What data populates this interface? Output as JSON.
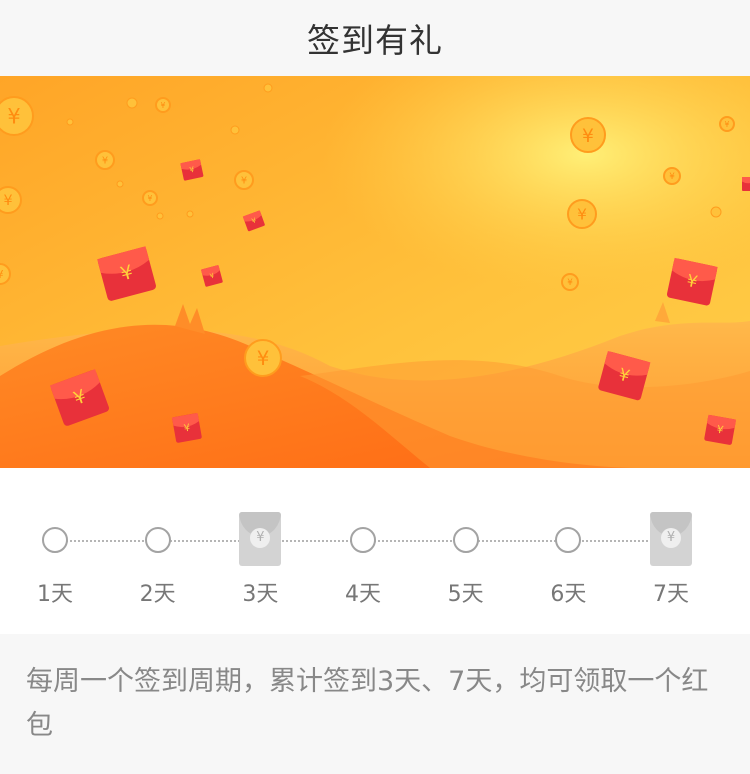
{
  "header": {
    "title": "签到有礼"
  },
  "banner": {
    "currency_symbol": "¥"
  },
  "checkin": {
    "days": [
      {
        "label": "1天",
        "reward": false
      },
      {
        "label": "2天",
        "reward": false
      },
      {
        "label": "3天",
        "reward": true
      },
      {
        "label": "4天",
        "reward": false
      },
      {
        "label": "5天",
        "reward": false
      },
      {
        "label": "6天",
        "reward": false
      },
      {
        "label": "7天",
        "reward": true
      }
    ]
  },
  "description": "每周一个签到周期，累计签到3天、7天，均可领取一个红包",
  "colors": {
    "banner_bg": "#ffb335",
    "hill": "#ff7f1f",
    "envelope": "#e8313a",
    "coin": "#ffc13a",
    "reward_gray": "#d3d3d3"
  }
}
